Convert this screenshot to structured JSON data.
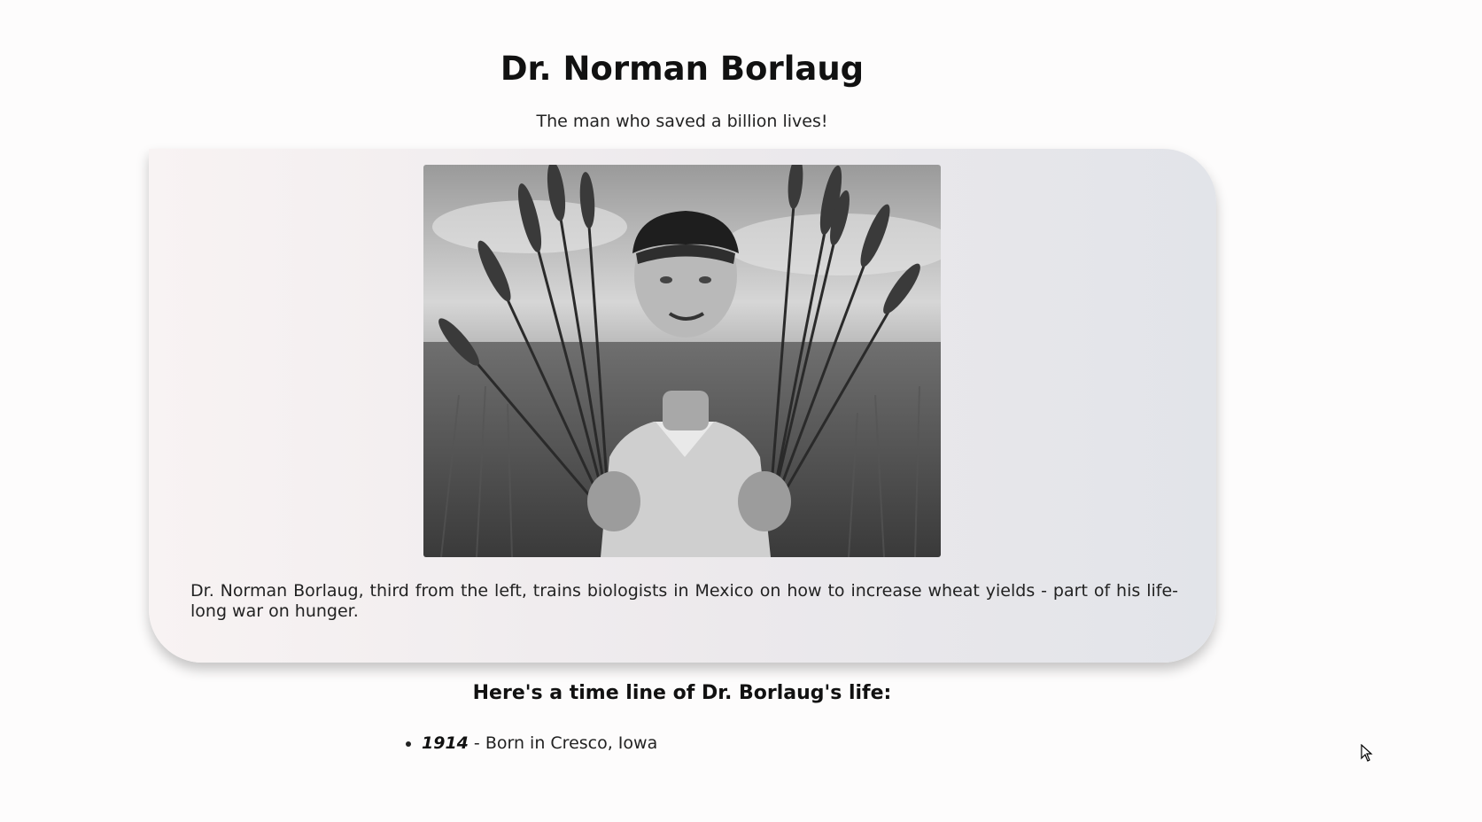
{
  "header": {
    "title": "Dr. Norman Borlaug",
    "subtitle": "The man who saved a billion lives!"
  },
  "figure": {
    "image_desc": "black-and-white-photo-man-holding-wheat-bundles",
    "caption": "Dr. Norman Borlaug, third from the left, trains biologists in Mexico on how to increase wheat yields - part of his life-long war on hunger."
  },
  "timeline": {
    "heading": "Here's a time line of Dr. Borlaug's life:",
    "items": [
      {
        "year": "1914",
        "text": " - Born in Cresco, Iowa"
      }
    ]
  },
  "colors": {
    "card_gradient_start": "#f8f3f3",
    "card_gradient_end": "#e2e4e9"
  }
}
